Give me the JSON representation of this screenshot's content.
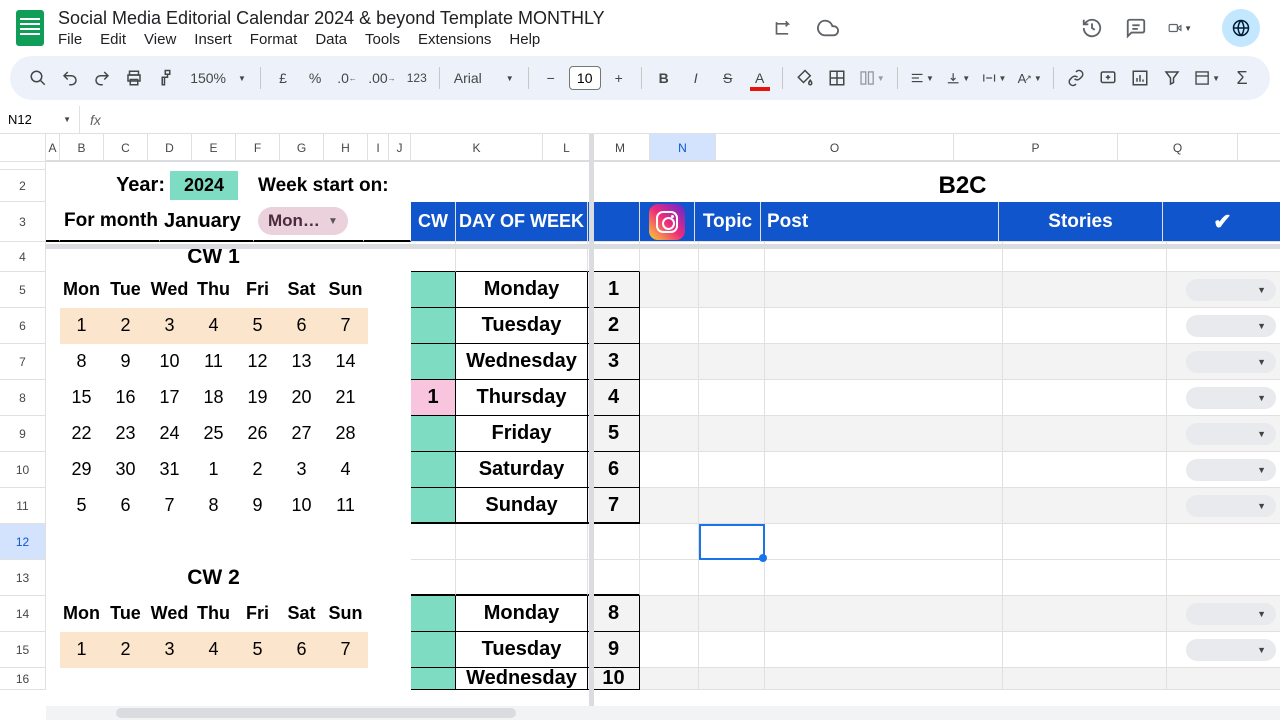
{
  "doc": {
    "title": "Social Media Editorial Calendar 2024 & beyond Template MONTHLY"
  },
  "menus": {
    "file": "File",
    "edit": "Edit",
    "view": "View",
    "insert": "Insert",
    "format": "Format",
    "data": "Data",
    "tools": "Tools",
    "extensions": "Extensions",
    "help": "Help"
  },
  "toolbar": {
    "zoom": "150%",
    "font": "Arial",
    "fontSize": "10",
    "currency": "£",
    "percent": "%",
    "format123": "123"
  },
  "nameBox": "N12",
  "cols": {
    "A": "A",
    "B": "B",
    "C": "C",
    "D": "D",
    "E": "E",
    "F": "F",
    "G": "G",
    "H": "H",
    "I": "I",
    "J": "J",
    "K": "K",
    "L": "L",
    "M": "M",
    "N": "N",
    "O": "O",
    "P": "P",
    "Q": "Q"
  },
  "rows": {
    "r2": "2",
    "r3": "3",
    "r4": "4",
    "r5": "5",
    "r6": "6",
    "r7": "7",
    "r8": "8",
    "r9": "9",
    "r10": "10",
    "r11": "11",
    "r12": "12",
    "r13": "13",
    "r14": "14",
    "r15": "15",
    "r16": "16"
  },
  "labels": {
    "yearLabel": "Year:",
    "year": "2024",
    "weekStart": "Week start on:",
    "forMonth": "For month:",
    "month": "January",
    "monthChip": "Mon…",
    "cwHeader": "CW",
    "dowHeader": "DAY OF WEEK",
    "b2c": "B2C",
    "topic": "Topic",
    "post": "Post",
    "stories": "Stories",
    "check": "✔",
    "cw1": "CW  1",
    "cw2": "CW  2"
  },
  "dowShort": {
    "mon": "Mon",
    "tue": "Tue",
    "wed": "Wed",
    "thu": "Thu",
    "fri": "Fri",
    "sat": "Sat",
    "sun": "Sun"
  },
  "dowLong": {
    "mon": "Monday",
    "tue": "Tuesday",
    "wed": "Wednesday",
    "thu": "Thursday",
    "fri": "Friday",
    "sat": "Saturday",
    "sun": "Sunday"
  },
  "cal": {
    "w1": {
      "d1": "1",
      "d2": "2",
      "d3": "3",
      "d4": "4",
      "d5": "5",
      "d6": "6",
      "d7": "7"
    },
    "w2": {
      "d1": "8",
      "d2": "9",
      "d3": "10",
      "d4": "11",
      "d5": "12",
      "d6": "13",
      "d7": "14"
    },
    "w3": {
      "d1": "15",
      "d2": "16",
      "d3": "17",
      "d4": "18",
      "d5": "19",
      "d6": "20",
      "d7": "21"
    },
    "w4": {
      "d1": "22",
      "d2": "23",
      "d3": "24",
      "d4": "25",
      "d5": "26",
      "d6": "27",
      "d7": "28"
    },
    "w5": {
      "d1": "29",
      "d2": "30",
      "d3": "31",
      "d4": "1",
      "d5": "2",
      "d6": "3",
      "d7": "4"
    },
    "w6": {
      "d1": "5",
      "d2": "6",
      "d3": "7",
      "d4": "8",
      "d5": "9",
      "d6": "10",
      "d7": "11"
    }
  },
  "dayNums": {
    "d1": "1",
    "d2": "2",
    "d3": "3",
    "d4": "4",
    "d5": "5",
    "d6": "6",
    "d7": "7",
    "d8": "8",
    "d9": "9",
    "d10": "10"
  },
  "cwNum": {
    "one": "1"
  }
}
